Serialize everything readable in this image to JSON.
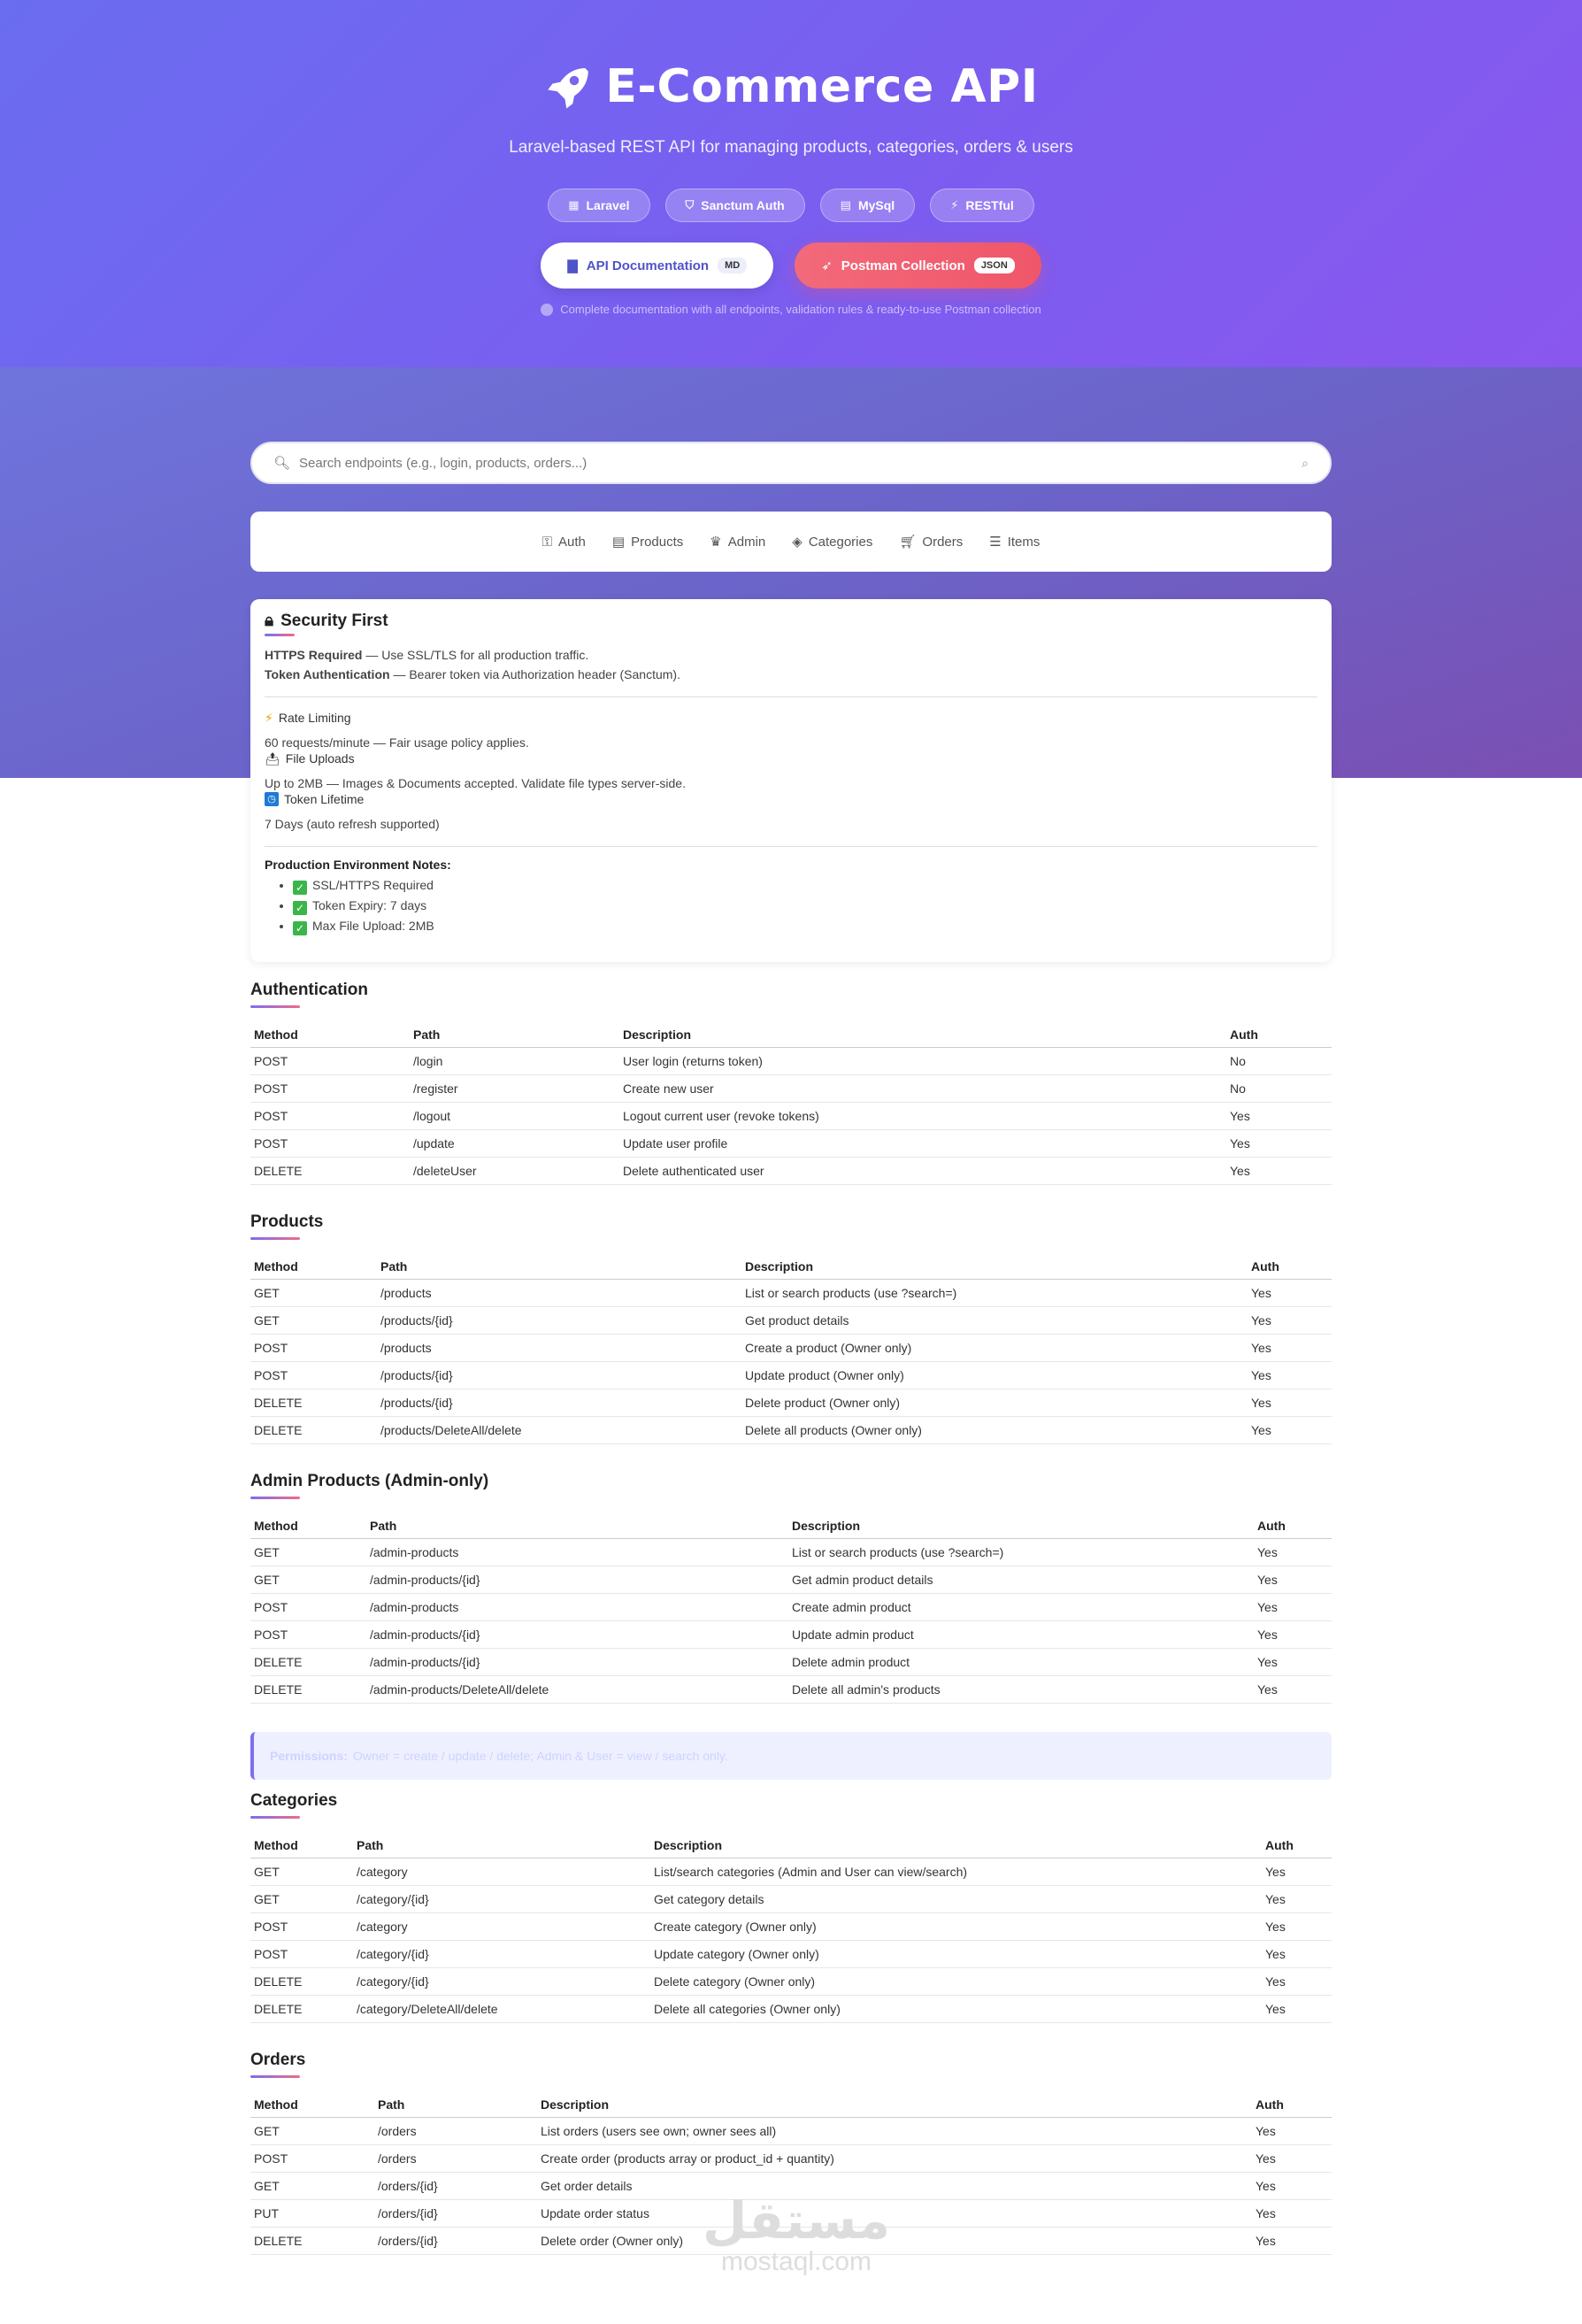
{
  "hero": {
    "title": "E-Commerce API",
    "subtitle": "Laravel-based REST API for managing products, categories, orders & users",
    "badges": [
      {
        "label": "Laravel",
        "icon": "laravel-icon"
      },
      {
        "label": "Sanctum Auth",
        "icon": "shield-icon"
      },
      {
        "label": "MySql",
        "icon": "database-icon"
      },
      {
        "label": "RESTful",
        "icon": "bolt-icon"
      }
    ],
    "doc_button": {
      "label": "API Documentation",
      "tag": "MD"
    },
    "postman_button": {
      "label": "Postman Collection",
      "tag": "JSON"
    },
    "note": "Complete documentation with all endpoints, validation rules & ready-to-use Postman collection"
  },
  "search": {
    "placeholder": "Search endpoints (e.g., login, products, orders...)"
  },
  "nav": [
    {
      "label": "Auth",
      "icon": "key-icon"
    },
    {
      "label": "Products",
      "icon": "box-icon"
    },
    {
      "label": "Admin",
      "icon": "crown-icon"
    },
    {
      "label": "Categories",
      "icon": "tag-icon"
    },
    {
      "label": "Orders",
      "icon": "cart-icon"
    },
    {
      "label": "Items",
      "icon": "list-icon"
    }
  ],
  "security": {
    "title": "Security First",
    "https_label": "HTTPS Required",
    "https_text": " — Use SSL/TLS for all production traffic.",
    "token_label": "Token Authentication",
    "token_text": " — Bearer token via Authorization header (Sanctum).",
    "rate_label": "Rate Limiting",
    "rate_text": "60 requests/minute — Fair usage policy applies.",
    "upload_label": "File Uploads",
    "upload_text": "Up to 2MB — Images & Documents accepted. Validate file types server-side.",
    "lifetime_label": "Token Lifetime",
    "lifetime_text": "7 Days (auto refresh supported)",
    "notes_title": "Production Environment Notes:",
    "notes": [
      "SSL/HTTPS Required",
      "Token Expiry: 7 days",
      "Max File Upload: 2MB"
    ]
  },
  "columns": {
    "method": "Method",
    "path": "Path",
    "description": "Description",
    "auth": "Auth"
  },
  "sections": {
    "authentication": {
      "title": "Authentication",
      "rows": [
        [
          "POST",
          "/login",
          "User login (returns token)",
          "No"
        ],
        [
          "POST",
          "/register",
          "Create new user",
          "No"
        ],
        [
          "POST",
          "/logout",
          "Logout current user (revoke tokens)",
          "Yes"
        ],
        [
          "POST",
          "/update",
          "Update user profile",
          "Yes"
        ],
        [
          "DELETE",
          "/deleteUser",
          "Delete authenticated user",
          "Yes"
        ]
      ]
    },
    "products": {
      "title": "Products",
      "rows": [
        [
          "GET",
          "/products",
          "List or search products (use ?search=)",
          "Yes"
        ],
        [
          "GET",
          "/products/{id}",
          "Get product details",
          "Yes"
        ],
        [
          "POST",
          "/products",
          "Create a product (Owner only)",
          "Yes"
        ],
        [
          "POST",
          "/products/{id}",
          "Update product (Owner only)",
          "Yes"
        ],
        [
          "DELETE",
          "/products/{id}",
          "Delete product (Owner only)",
          "Yes"
        ],
        [
          "DELETE",
          "/products/DeleteAll/delete",
          "Delete all products (Owner only)",
          "Yes"
        ]
      ]
    },
    "admin_products": {
      "title": "Admin Products (Admin-only)",
      "rows": [
        [
          "GET",
          "/admin-products",
          "List or search products (use ?search=)",
          "Yes"
        ],
        [
          "GET",
          "/admin-products/{id}",
          "Get admin product details",
          "Yes"
        ],
        [
          "POST",
          "/admin-products",
          "Create admin product",
          "Yes"
        ],
        [
          "POST",
          "/admin-products/{id}",
          "Update admin product",
          "Yes"
        ],
        [
          "DELETE",
          "/admin-products/{id}",
          "Delete admin product",
          "Yes"
        ],
        [
          "DELETE",
          "/admin-products/DeleteAll/delete",
          "Delete all admin's products",
          "Yes"
        ]
      ]
    },
    "categories": {
      "title": "Categories",
      "rows": [
        [
          "GET",
          "/category",
          "List/search categories (Admin and User can view/search)",
          "Yes"
        ],
        [
          "GET",
          "/category/{id}",
          "Get category details",
          "Yes"
        ],
        [
          "POST",
          "/category",
          "Create category (Owner only)",
          "Yes"
        ],
        [
          "POST",
          "/category/{id}",
          "Update category (Owner only)",
          "Yes"
        ],
        [
          "DELETE",
          "/category/{id}",
          "Delete category (Owner only)",
          "Yes"
        ],
        [
          "DELETE",
          "/category/DeleteAll/delete",
          "Delete all categories (Owner only)",
          "Yes"
        ]
      ]
    },
    "orders": {
      "title": "Orders",
      "rows": [
        [
          "GET",
          "/orders",
          "List orders (users see own; owner sees all)",
          "Yes"
        ],
        [
          "POST",
          "/orders",
          "Create order (products array or product_id + quantity)",
          "Yes"
        ],
        [
          "GET",
          "/orders/{id}",
          "Get order details",
          "Yes"
        ],
        [
          "PUT",
          "/orders/{id}",
          "Update order status",
          "Yes"
        ],
        [
          "DELETE",
          "/orders/{id}",
          "Delete order (Owner only)",
          "Yes"
        ]
      ]
    }
  },
  "permissions": {
    "label": "Permissions:",
    "text": "Owner = create / update / delete; Admin & User = view / search only."
  },
  "watermark": {
    "arabic": "مستقل",
    "latin": "mostaql.com"
  },
  "colors": {
    "accent": "#7b6ef0",
    "postman": "#f0566a",
    "hero_start": "#6a6df0",
    "hero_end": "#8a57ee"
  }
}
